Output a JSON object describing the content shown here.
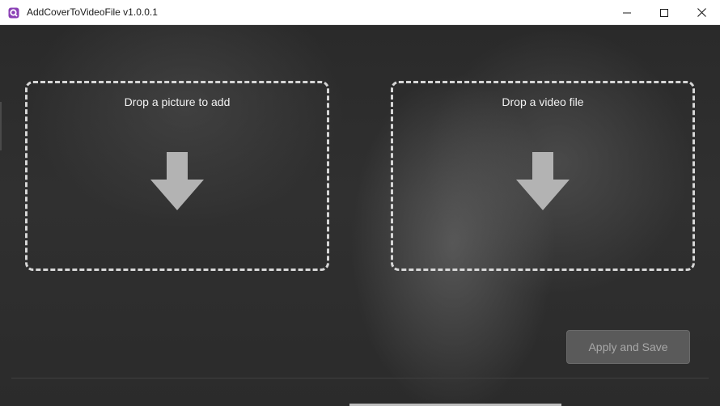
{
  "window": {
    "title": "AddCoverToVideoFile v1.0.0.1",
    "controls": {
      "minimize": "minimize-icon",
      "maximize": "maximize-icon",
      "close": "close-icon"
    }
  },
  "dropzones": {
    "picture": {
      "label": "Drop a picture to add",
      "icon": "down-arrow-icon"
    },
    "video": {
      "label": "Drop a video file",
      "icon": "down-arrow-icon"
    }
  },
  "actions": {
    "apply_save_label": "Apply and Save",
    "apply_save_enabled": false
  },
  "colors": {
    "background": "#262626",
    "dashed_border": "#d6d6d6",
    "arrow": "#b3b3b3",
    "button_disabled": "#5a5a5a",
    "app_icon_accent": "#8a3fb5"
  }
}
